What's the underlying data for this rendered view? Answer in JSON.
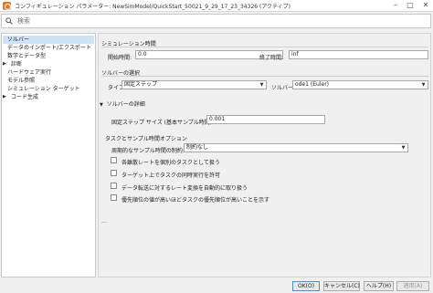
{
  "window": {
    "title": "コンフィギュレーション パラメーター: NewSimModel/QuickStart_50021_9_29_17_23_34326 (アクティブ)",
    "min_glyph": "–",
    "max_glyph": "□",
    "close_glyph": "✕"
  },
  "search": {
    "placeholder": "検索"
  },
  "tree": {
    "items": [
      {
        "label": "ソルバー",
        "selected": true,
        "expandable": false
      },
      {
        "label": "データのインポート/エクスポート",
        "selected": false,
        "expandable": false
      },
      {
        "label": "数学とデータ型",
        "selected": false,
        "expandable": false
      },
      {
        "label": "診断",
        "selected": false,
        "expandable": true
      },
      {
        "label": "ハードウェア実行",
        "selected": false,
        "expandable": false
      },
      {
        "label": "モデル参照",
        "selected": false,
        "expandable": false
      },
      {
        "label": "シミュレーション ターゲット",
        "selected": false,
        "expandable": false
      },
      {
        "label": "コード生成",
        "selected": false,
        "expandable": true
      }
    ]
  },
  "sim_time": {
    "section_title": "シミュレーション時間",
    "start_label": "開始時間:",
    "start_value": "0.0",
    "stop_label": "終了時間:",
    "stop_value": "inf"
  },
  "solver_select": {
    "section_title": "ソルバーの選択",
    "type_label": "タイプ:",
    "type_value": "固定ステップ",
    "solver_label": "ソルバー:",
    "solver_value": "ode1 (Euler)"
  },
  "solver_details": {
    "section_title": "ソルバーの詳細",
    "step_label": "固定ステップ サイズ (基本サンプル時間):",
    "step_value": "0.001"
  },
  "tasking": {
    "section_title": "タスクとサンプル時間オプション",
    "periodic_label": "周期的なサンプル時間の制約:",
    "periodic_value": "制約なし",
    "checkboxes": [
      {
        "label": "各離散レートを個別のタスクとして扱う",
        "checked": false
      },
      {
        "label": "ターゲット上でタスクの同時実行を許可",
        "checked": false
      },
      {
        "label": "データ転送に対するレート変換を自動的に取り扱う",
        "checked": false
      },
      {
        "label": "優先順位の値が高いほどタスクの優先順位が高いことを示す",
        "checked": false
      }
    ]
  },
  "more": "...",
  "footer": {
    "ok": "OK(O)",
    "cancel": "キャンセル(C)",
    "help": "ヘルプ(H)",
    "apply": "適用(A)"
  }
}
